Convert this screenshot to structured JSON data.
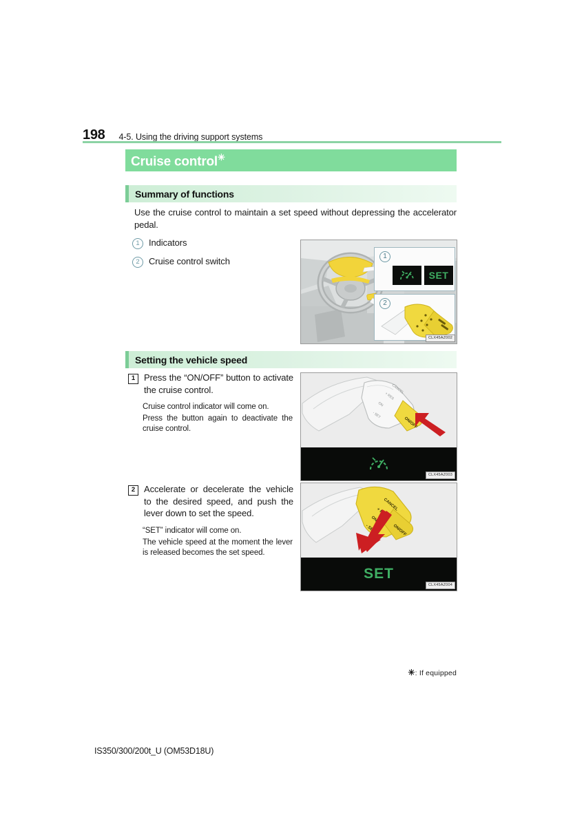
{
  "page": {
    "number": "198",
    "breadcrumb": "4-5. Using the driving support systems",
    "footer": "IS350/300/200t_U (OM53D18U)",
    "footnote_star": "✳",
    "footnote_text": ": If equipped",
    "accent_green": "#80dc9c",
    "rule_green": "#8bd3a4",
    "indicator_green": "#3fae63",
    "circle_blue": "#6e9aa6"
  },
  "chapter": {
    "title": "Cruise control",
    "title_asterisk": "✳"
  },
  "sections": {
    "summary": {
      "heading": "Summary of functions",
      "intro": "Use the cruise control to maintain a set speed without depressing the accelerator pedal.",
      "callouts": [
        {
          "num": "1",
          "label": "Indicators"
        },
        {
          "num": "2",
          "label": "Cruise control switch"
        }
      ]
    },
    "setting": {
      "heading": "Setting the vehicle speed",
      "steps": [
        {
          "num": "1",
          "main": "Press the “ON/OFF” button to activate the cruise control.",
          "sub": [
            "Cruise control indicator will come on.",
            "Press the button again to deactivate the cruise control."
          ]
        },
        {
          "num": "2",
          "main": "Accelerate or decelerate the vehicle to the desired speed, and push the lever down to set the speed.",
          "sub": [
            "“SET” indicator will come on.",
            "The vehicle speed at the moment the lever is released becomes the set speed."
          ]
        }
      ]
    }
  },
  "figures": {
    "fig1": {
      "caption": "CLX45AZ002",
      "callout_1_num": "1",
      "callout_2_num": "2",
      "indicator_set_label": "SET"
    },
    "fig2": {
      "caption": "CLX45AZ003"
    },
    "fig3": {
      "caption": "CLX45AZ004",
      "indicator_label": "SET"
    }
  }
}
